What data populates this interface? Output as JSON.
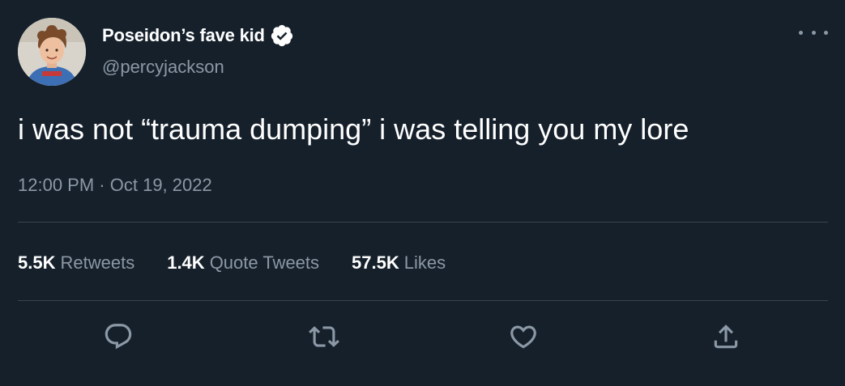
{
  "author": {
    "display_name": "Poseidon’s fave kid",
    "handle": "@percyjackson",
    "verified": true,
    "avatar_icon": "avatar-photo"
  },
  "tweet": {
    "text": "i was not “trauma dumping” i was telling you my lore",
    "time": "12:00 PM",
    "separator": "·",
    "date": "Oct 19, 2022"
  },
  "stats": {
    "retweets_count": "5.5K",
    "retweets_label": "Retweets",
    "quotes_count": "1.4K",
    "quotes_label": "Quote Tweets",
    "likes_count": "57.5K",
    "likes_label": "Likes"
  },
  "actions": {
    "reply_icon": "reply-icon",
    "retweet_icon": "retweet-icon",
    "like_icon": "heart-icon",
    "share_icon": "share-icon"
  },
  "colors": {
    "background": "#15202b",
    "primary_text": "#ffffff",
    "secondary_text": "#8b98a5",
    "divider": "#38444d",
    "verified": "#ffffff"
  }
}
